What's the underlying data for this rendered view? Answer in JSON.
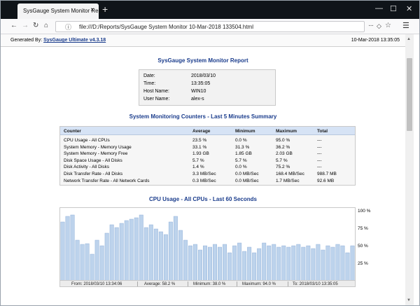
{
  "browser": {
    "tab_title": "SysGauge System Monitor Report",
    "tab_close": "×",
    "new_tab": "+",
    "url": "file:///D:/Reports/SysGauge System Monitor 10-Mar-2018 133504.html",
    "url_more": "···",
    "window_min": "—",
    "window_max": "☐",
    "window_close": "✕"
  },
  "generated": {
    "prefix": "Generated By: ",
    "link": "SysGauge Ultimate v4.3.18",
    "date": "10-Mar-2018 13:35:05"
  },
  "report": {
    "title": "SysGauge System Monitor Report",
    "info": [
      {
        "label": "Date:",
        "value": "2018/03/10"
      },
      {
        "label": "Time:",
        "value": "13:35:05"
      },
      {
        "label": "Host Name:",
        "value": "WIN10"
      },
      {
        "label": "User Name:",
        "value": "alex-s"
      }
    ]
  },
  "summary": {
    "title": "System Monitoring Counters - Last 5 Minutes Summary",
    "headers": [
      "Counter",
      "Average",
      "Minimum",
      "Maximum",
      "Total"
    ],
    "rows": [
      [
        "CPU Usage - All CPUs",
        "23.5 %",
        "0.0 %",
        "95.0 %",
        "---"
      ],
      [
        "System Memory - Memory Usage",
        "33.1 %",
        "31.3 %",
        "36.2 %",
        "---"
      ],
      [
        "System Memory - Memory Free",
        "1.93 GB",
        "1.85 GB",
        "2.03 GB",
        "---"
      ],
      [
        "Disk Space Usage - All Disks",
        "5.7 %",
        "5.7 %",
        "5.7 %",
        "---"
      ],
      [
        "Disk Activity - All Disks",
        "1.4 %",
        "0.0 %",
        "75.2 %",
        "---"
      ],
      [
        "Disk Transfer Rate - All Disks",
        "3.3 MB/Sec",
        "0.0 MB/Sec",
        "168.4 MB/Sec",
        "988.7 MB"
      ],
      [
        "Network Transfer Rate - All Network Cards",
        "0.3 MB/Sec",
        "0.0 MB/Sec",
        "1.7 MB/Sec",
        "92.6 MB"
      ]
    ]
  },
  "cpu_chart": {
    "title": "CPU Usage - All CPUs - Last 60 Seconds",
    "footer": {
      "from": "From: 2018/03/10  13:34:06",
      "average": "Average: 58.2 %",
      "minimum": "Minimum: 38.0 %",
      "maximum": "Maximum: 94.0 %",
      "to": "To: 2018/03/10  13:35:05"
    },
    "y_ticks": [
      "100 %",
      "75 %",
      "50 %",
      "25 %"
    ]
  },
  "colors": {
    "bar_fill": "#bdd3ec",
    "bar_stroke": "#8fb0d8",
    "title_blue": "#1a3c8c",
    "table_header": "#d6e3f5"
  },
  "chart_data": {
    "type": "bar",
    "title": "CPU Usage - All CPUs - Last 60 Seconds",
    "xlabel": "",
    "ylabel": "",
    "ylim": [
      0,
      100
    ],
    "y_ticks": [
      25,
      50,
      75,
      100
    ],
    "grid": false,
    "values": [
      84,
      92,
      94,
      58,
      52,
      53,
      38,
      58,
      50,
      68,
      80,
      76,
      82,
      86,
      88,
      90,
      94,
      76,
      80,
      74,
      70,
      66,
      84,
      92,
      72,
      58,
      50,
      52,
      44,
      50,
      48,
      52,
      48,
      52,
      40,
      50,
      54,
      42,
      48,
      40,
      46,
      54,
      50,
      52,
      48,
      50,
      48,
      50,
      52,
      48,
      50,
      46,
      52,
      44,
      50,
      48,
      52,
      50,
      40,
      50
    ]
  }
}
